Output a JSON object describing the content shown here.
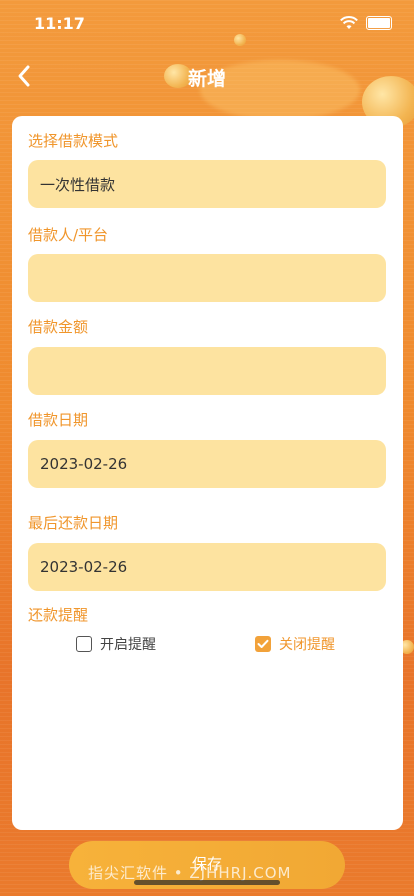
{
  "status_bar": {
    "time": "11:17"
  },
  "nav": {
    "title": "新增"
  },
  "form": {
    "mode_label": "选择借款模式",
    "mode_value": "一次性借款",
    "lender_label": "借款人/平台",
    "lender_value": "",
    "amount_label": "借款金额",
    "amount_value": "",
    "date_label": "借款日期",
    "date_value": "2023-02-26",
    "last_date_label": "最后还款日期",
    "last_date_value": "2023-02-26",
    "reminder_label": "还款提醒",
    "reminder_on_label": "开启提醒",
    "reminder_off_label": "关闭提醒",
    "reminder_on_checked": false,
    "reminder_off_checked": true
  },
  "save_label": "保存",
  "watermark": "指尖汇软件 • ZJHHRJ.COM",
  "colors": {
    "accent": "#f0962c",
    "field_bg": "#fde3a0",
    "checkbox_checked": "#f2a23a"
  },
  "icons": [
    "back-chevron-icon",
    "wifi-icon",
    "battery-icon",
    "checkbox-icon",
    "checkmark-icon"
  ]
}
